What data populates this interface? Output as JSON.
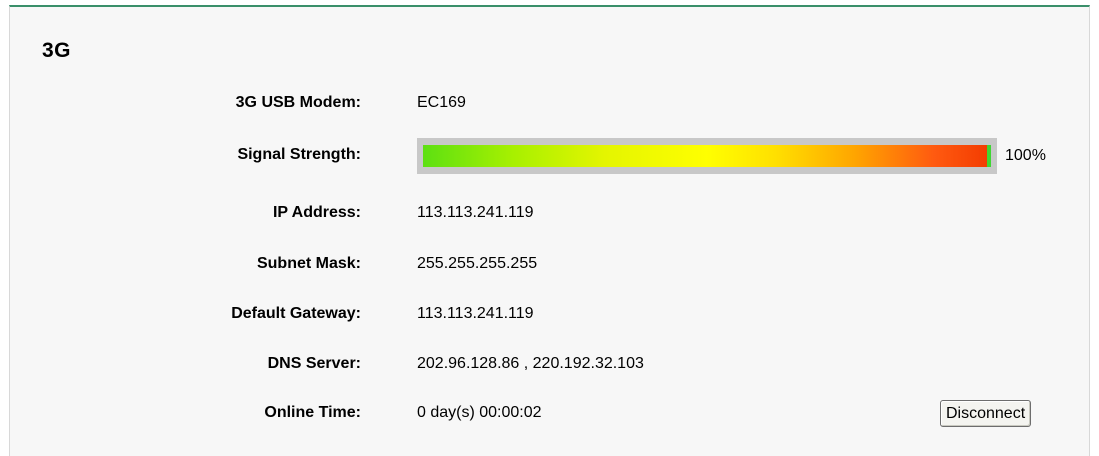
{
  "section": {
    "title": "3G"
  },
  "modem": {
    "label": "3G USB Modem:",
    "value": "EC169"
  },
  "signal": {
    "label": "Signal Strength:",
    "percent_text": "100%",
    "level": 1.0
  },
  "ip": {
    "label": "IP Address:",
    "value": "113.113.241.119"
  },
  "subnet": {
    "label": "Subnet Mask:",
    "value": "255.255.255.255"
  },
  "gateway": {
    "label": "Default Gateway:",
    "value": "113.113.241.119"
  },
  "dns": {
    "label": "DNS Server:",
    "value": "202.96.128.86 , 220.192.32.103"
  },
  "online": {
    "label": "Online Time:",
    "value": "0 day(s) 00:00:02"
  },
  "actions": {
    "disconnect_label": "Disconnect"
  },
  "colors": {
    "header_rule": "#3a8f6a",
    "panel_background": "#f7f7f7"
  }
}
